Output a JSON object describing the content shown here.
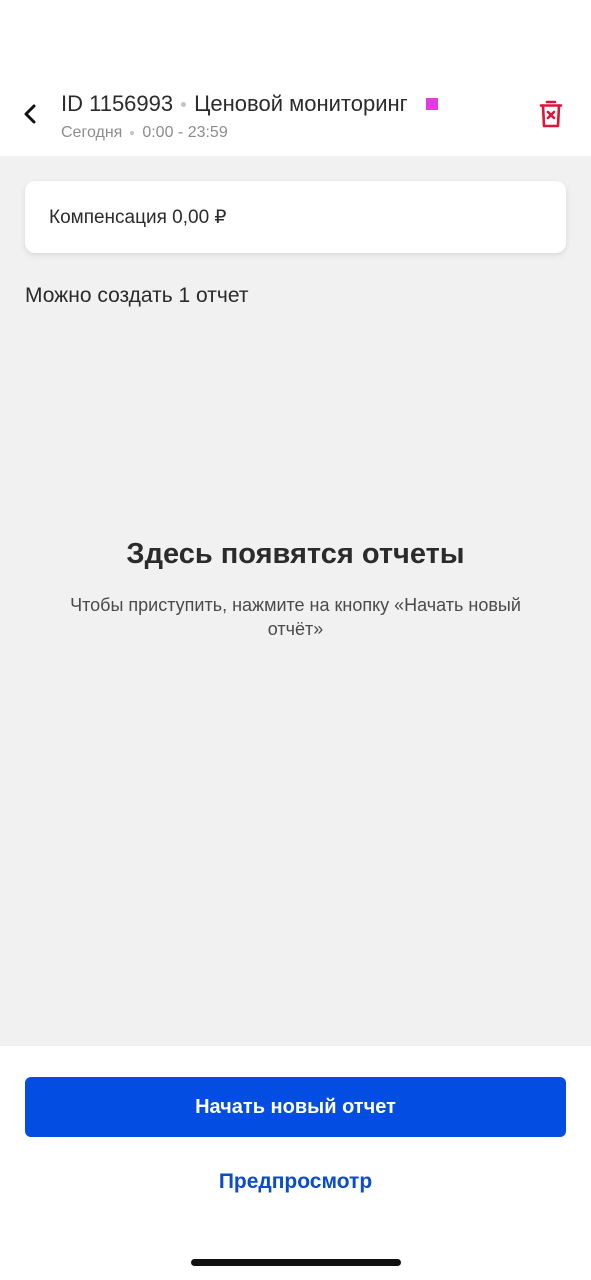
{
  "header": {
    "back_icon": "chevron-left-icon",
    "task_id": "ID 1156993",
    "task_title": "Ценовой мониторинг",
    "day_label": "Сегодня",
    "time_range": "0:00 - 23:59",
    "status_color": "#e33ae6",
    "delete_icon": "trash-x-icon",
    "delete_color": "#e0133a"
  },
  "compensation": {
    "text": "Компенсация 0,00 ₽"
  },
  "reports": {
    "can_create_text": "Можно создать 1 отчет",
    "empty_title": "Здесь появятся отчеты",
    "empty_description": "Чтобы приступить, нажмите на кнопку «Начать новый отчёт»"
  },
  "actions": {
    "start_label": "Начать новый отчет",
    "preview_label": "Предпросмотр",
    "accent_color": "#044de3",
    "link_color": "#0b4cc9"
  }
}
